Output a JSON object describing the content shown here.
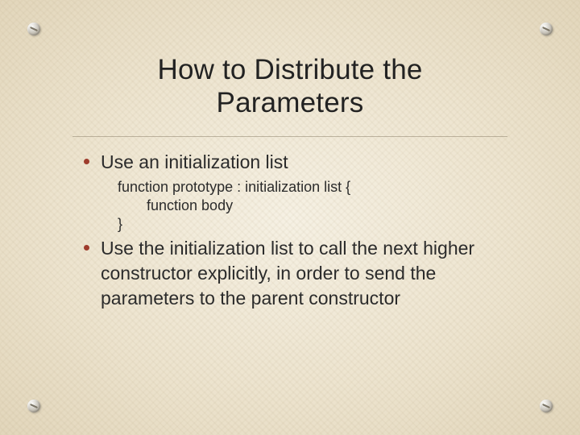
{
  "title_line1": "How to Distribute the",
  "title_line2": "Parameters",
  "bullets": {
    "b1": "Use an initialization list",
    "code_line1": "function prototype : initialization list {",
    "code_line2": "function body",
    "code_line3": "}",
    "b2": "Use the initialization list to call the next higher constructor explicitly, in order to send the parameters to the parent constructor"
  }
}
